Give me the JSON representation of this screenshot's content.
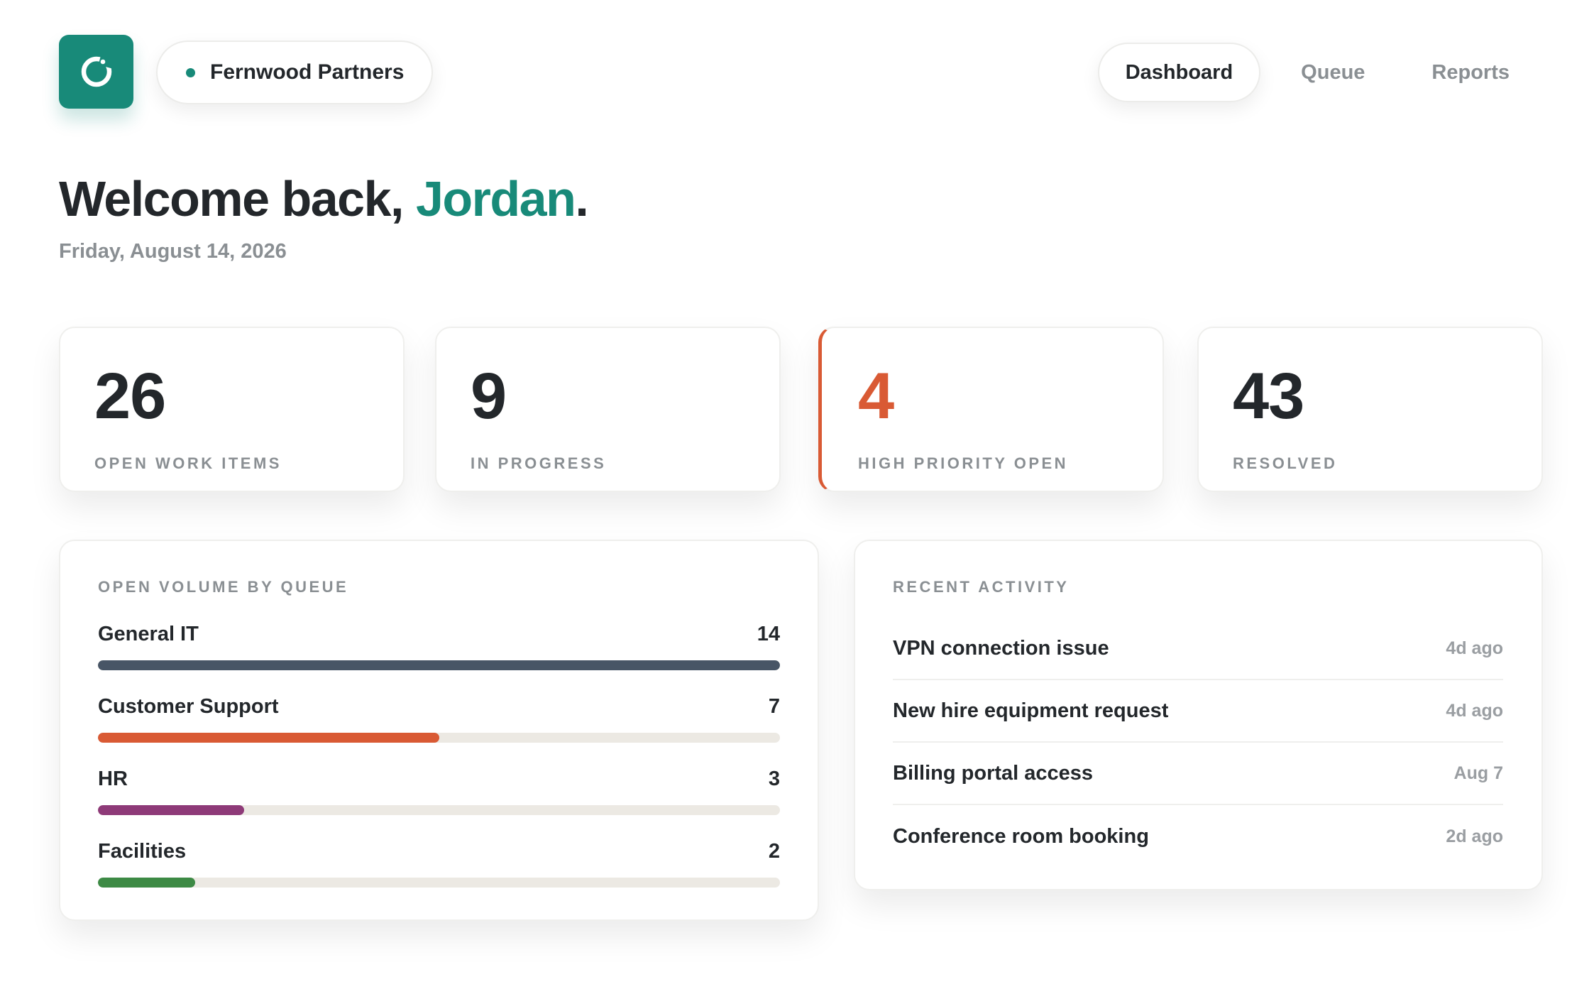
{
  "header": {
    "org_name": "Fernwood Partners",
    "brand_color": "#188a79",
    "logo_icon": "ring-icon",
    "nav": [
      {
        "label": "Dashboard",
        "active": true
      },
      {
        "label": "Queue",
        "active": false
      },
      {
        "label": "Reports",
        "active": false
      }
    ]
  },
  "greeting": {
    "prefix": "Welcome back, ",
    "name": "Jordan",
    "suffix": ".",
    "date": "Friday, August 14, 2026"
  },
  "stats": [
    {
      "value": "26",
      "label": "OPEN WORK ITEMS"
    },
    {
      "value": "9",
      "label": "IN PROGRESS"
    },
    {
      "value": "4",
      "label": "HIGH PRIORITY OPEN",
      "accent": "#d95a34"
    },
    {
      "value": "43",
      "label": "RESOLVED"
    }
  ],
  "queue_panel": {
    "title": "OPEN VOLUME BY QUEUE",
    "max": 14,
    "items": [
      {
        "name": "General IT",
        "count": "14",
        "value": 14,
        "color": "#485566"
      },
      {
        "name": "Customer Support",
        "count": "7",
        "value": 7,
        "color": "#d95a34"
      },
      {
        "name": "HR",
        "count": "3",
        "value": 3,
        "color": "#8e3a78"
      },
      {
        "name": "Facilities",
        "count": "2",
        "value": 2,
        "color": "#3d8a45"
      }
    ]
  },
  "activity_panel": {
    "title": "RECENT ACTIVITY",
    "items": [
      {
        "title": "VPN connection issue",
        "time": "4d ago"
      },
      {
        "title": "New hire equipment request",
        "time": "4d ago"
      },
      {
        "title": "Billing portal access",
        "time": "Aug 7"
      },
      {
        "title": "Conference room booking",
        "time": "2d ago"
      }
    ]
  }
}
